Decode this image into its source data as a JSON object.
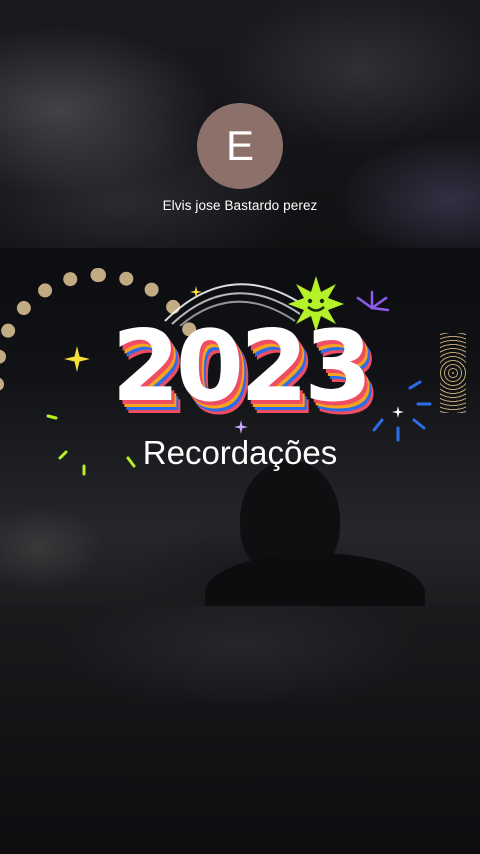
{
  "profile": {
    "avatar_letter": "E",
    "avatar_color": "#8c716b",
    "username": "Elvis jose Bastardo perez"
  },
  "video": {
    "year": "2023",
    "subtitle": "Recordações",
    "stripe_colors": [
      "#ef4d61",
      "#f6a41f",
      "#2b6de8"
    ],
    "decor_icons": [
      "smiley-sun-icon",
      "sparkle-icon",
      "firework-icon",
      "rainbow-arcs-icon"
    ]
  }
}
